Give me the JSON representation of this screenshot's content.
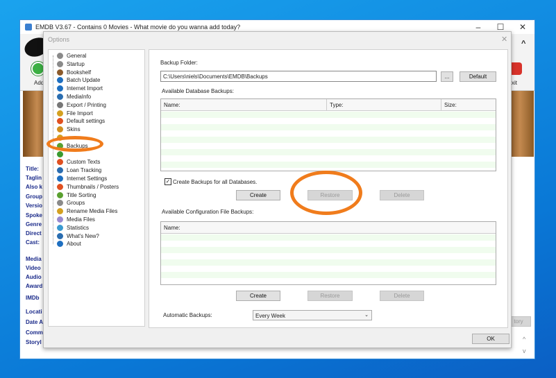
{
  "window": {
    "title": "EMDB V3.67 - Contains 0 Movies - What movie do you wanna add today?",
    "minimize": "–",
    "maximize": "☐",
    "close": "✕"
  },
  "toolbar": {
    "add_label": "Add",
    "exit_label": "xit",
    "collapse": "^"
  },
  "movie_fields": [
    "Title:",
    "Taglin",
    "Also k",
    "Group",
    "Versio",
    "Spoke",
    "Genre",
    "Direct",
    "Cast:",
    "Media",
    "Video",
    "Audio",
    "Award",
    "IMDb",
    "Locati",
    "Date A",
    "Comm",
    "Storyl"
  ],
  "history_button": "tory",
  "dialog": {
    "title": "Options",
    "close": "✕",
    "tree": [
      {
        "label": "General",
        "color": "#8a8a8a"
      },
      {
        "label": "Startup",
        "color": "#8a8a8a"
      },
      {
        "label": "Bookshelf",
        "color": "#8b5a2b"
      },
      {
        "label": "Batch Update",
        "color": "#1e6fc0"
      },
      {
        "label": "Internet Import",
        "color": "#1e6fc0"
      },
      {
        "label": "MediaInfo",
        "color": "#2a6db0"
      },
      {
        "label": "Export / Printing",
        "color": "#777"
      },
      {
        "label": "File Import",
        "color": "#d4a020"
      },
      {
        "label": "Default settings",
        "color": "#e05020"
      },
      {
        "label": "Skins",
        "color": "#d09020"
      },
      {
        "label": "",
        "color": "#d4a020"
      },
      {
        "label": "Backups",
        "color": "#5aa030"
      },
      {
        "label": "",
        "color": "#3a9a30"
      },
      {
        "label": "Custom Texts",
        "color": "#e05020"
      },
      {
        "label": "Loan Tracking",
        "color": "#2a6db0"
      },
      {
        "label": "Internet Settings",
        "color": "#1e6fc0"
      },
      {
        "label": "Thumbnails / Posters",
        "color": "#e05020"
      },
      {
        "label": "Title Sorting",
        "color": "#5aa030"
      },
      {
        "label": "Groups",
        "color": "#8a8a8a"
      },
      {
        "label": "Rename Media Files",
        "color": "#d4a020"
      },
      {
        "label": "Media Files",
        "color": "#9a8ad0"
      },
      {
        "label": "Statistics",
        "color": "#3a9ad0"
      },
      {
        "label": "What's New?",
        "color": "#2a6db0"
      },
      {
        "label": "About",
        "color": "#1e6fc0"
      }
    ],
    "backup_folder_label": "Backup Folder:",
    "backup_folder_value": "C:\\Users\\niels\\Documents\\EMDB\\Backups",
    "browse_label": "...",
    "default_label": "Default",
    "db_backups_label": "Available Database Backups:",
    "db_columns": [
      "Name:",
      "Type:",
      "Size:"
    ],
    "create_all_label": "Create Backups for all Databases.",
    "create_all_checked": true,
    "create_label": "Create",
    "restore_label": "Restore",
    "delete_label": "Delete",
    "config_backups_label": "Available Configuration File Backups:",
    "config_columns": [
      "Name:"
    ],
    "auto_backups_label": "Automatic Backups:",
    "auto_backups_value": "Every Week",
    "ok_label": "OK"
  },
  "colors": {
    "highlight": "#f07c1c",
    "desktop": "#0a78d6"
  }
}
